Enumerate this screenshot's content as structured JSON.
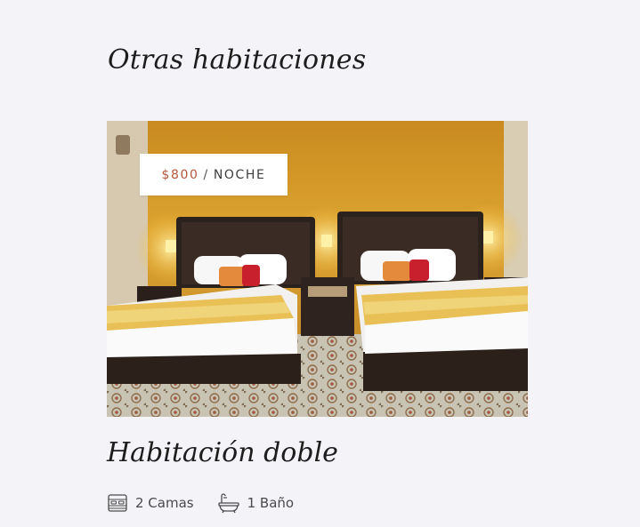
{
  "section": {
    "title": "Otras habitaciones"
  },
  "room": {
    "price": "$800",
    "separator": "/",
    "unit": "NOCHE",
    "name": "Habitación doble",
    "features": [
      {
        "icon": "bed-icon",
        "label": "2 Camas"
      },
      {
        "icon": "bathtub-icon",
        "label": "1 Baño"
      }
    ]
  },
  "colors": {
    "background": "#f4f3f8",
    "price_accent": "#b2573d",
    "text": "#1d1d1d"
  }
}
